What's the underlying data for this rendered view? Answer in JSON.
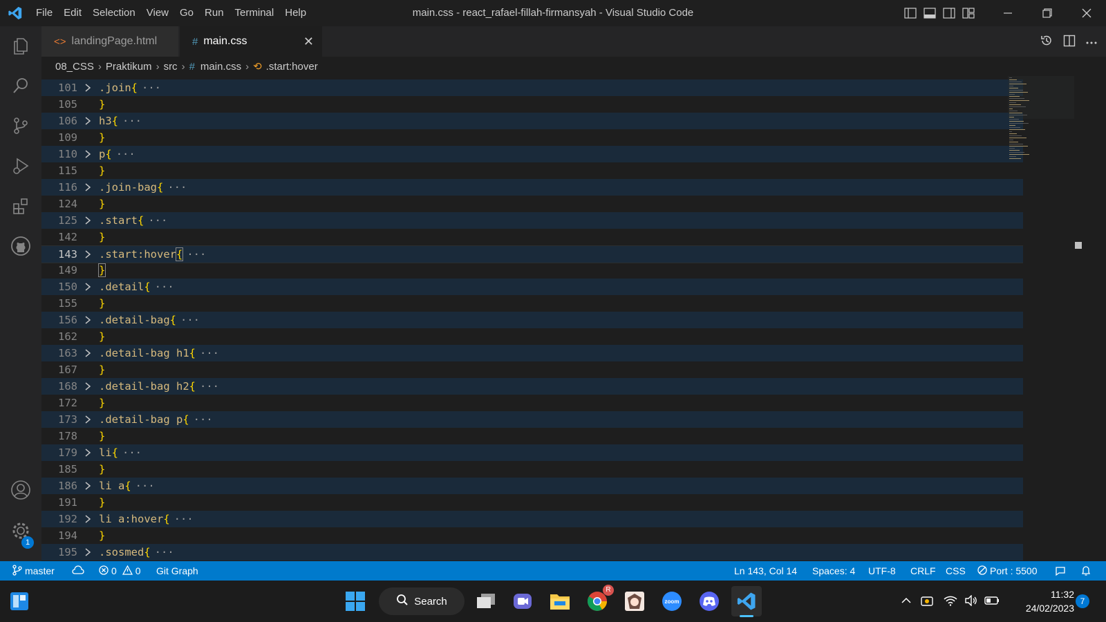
{
  "titlebar": {
    "menu": [
      "File",
      "Edit",
      "Selection",
      "View",
      "Go",
      "Run",
      "Terminal",
      "Help"
    ],
    "window_title": "main.css - react_rafael-fillah-firmansyah - Visual Studio Code",
    "icons": [
      "toggle-primary-sidebar-icon",
      "toggle-panel-icon",
      "toggle-secondary-sidebar-icon",
      "customize-layout-icon",
      "minimize-icon",
      "restore-icon",
      "close-icon"
    ]
  },
  "activitybar": {
    "items": [
      "explorer-icon",
      "search-icon",
      "source-control-icon",
      "run-debug-icon",
      "extensions-icon",
      "github-icon"
    ],
    "bottom": [
      "accounts-icon",
      "manage-gear-icon"
    ],
    "manage_badge": "1"
  },
  "tabs": [
    {
      "label": "landingPage.html",
      "icon": "html-file-icon",
      "active": false
    },
    {
      "label": "main.css",
      "icon_glyph": "#",
      "active": true,
      "close": "✕"
    }
  ],
  "breadcrumbs": {
    "items": [
      "08_CSS",
      "Praktikum",
      "src",
      "main.css",
      ".start:hover"
    ],
    "file_icon_glyph": "#"
  },
  "editor": {
    "lines": [
      {
        "no": "101",
        "folded": true,
        "sel": ".join"
      },
      {
        "no": "105",
        "folded": false,
        "close": "}"
      },
      {
        "no": "106",
        "folded": true,
        "sel": "h3"
      },
      {
        "no": "109",
        "folded": false,
        "close": "}"
      },
      {
        "no": "110",
        "folded": true,
        "sel": "p"
      },
      {
        "no": "115",
        "folded": false,
        "close": "}"
      },
      {
        "no": "116",
        "folded": true,
        "sel": ".join-bag"
      },
      {
        "no": "124",
        "folded": false,
        "close": "}"
      },
      {
        "no": "125",
        "folded": true,
        "sel": ".start"
      },
      {
        "no": "142",
        "folded": false,
        "close": "}"
      },
      {
        "no": "143",
        "folded": true,
        "sel": ".start:hover",
        "current": true
      },
      {
        "no": "149",
        "folded": false,
        "close": "}",
        "match": true
      },
      {
        "no": "150",
        "folded": true,
        "sel": ".detail"
      },
      {
        "no": "155",
        "folded": false,
        "close": "}"
      },
      {
        "no": "156",
        "folded": true,
        "sel": ".detail-bag"
      },
      {
        "no": "162",
        "folded": false,
        "close": "}"
      },
      {
        "no": "163",
        "folded": true,
        "sel": ".detail-bag h1"
      },
      {
        "no": "167",
        "folded": false,
        "close": "}"
      },
      {
        "no": "168",
        "folded": true,
        "sel": ".detail-bag h2"
      },
      {
        "no": "172",
        "folded": false,
        "close": "}"
      },
      {
        "no": "173",
        "folded": true,
        "sel": ".detail-bag p"
      },
      {
        "no": "178",
        "folded": false,
        "close": "}"
      },
      {
        "no": "179",
        "folded": true,
        "sel": "li"
      },
      {
        "no": "185",
        "folded": false,
        "close": "}"
      },
      {
        "no": "186",
        "folded": true,
        "sel": "li a"
      },
      {
        "no": "191",
        "folded": false,
        "close": "}"
      },
      {
        "no": "192",
        "folded": true,
        "sel": "li a:hover"
      },
      {
        "no": "194",
        "folded": false,
        "close": "}"
      },
      {
        "no": "195",
        "folded": true,
        "sel": ".sosmed"
      }
    ],
    "fold_open": "{",
    "ellipsis": "···"
  },
  "statusbar": {
    "branch": "master",
    "errors": "0",
    "warnings": "0",
    "git_graph": "Git Graph",
    "position": "Ln 143, Col 14",
    "spaces": "Spaces: 4",
    "encoding": "UTF-8",
    "eol": "CRLF",
    "language": "CSS",
    "port": "Port : 5500"
  },
  "taskbar": {
    "search_label": "Search",
    "apps": [
      "widgets-icon",
      "windows-start-icon",
      "task-view-icon",
      "teams-chat-icon",
      "file-explorer-icon",
      "chrome-icon",
      "anime-app-icon",
      "zoom-icon",
      "discord-icon",
      "vscode-icon"
    ],
    "chrome_badge": "R",
    "time": "11:32",
    "date": "24/02/2023",
    "notification_count": "7"
  },
  "colors": {
    "accent": "#007acc",
    "selector": "#d7ba7d",
    "brace": "#ffd700",
    "folded_line_bg": "#1a2a3a"
  }
}
